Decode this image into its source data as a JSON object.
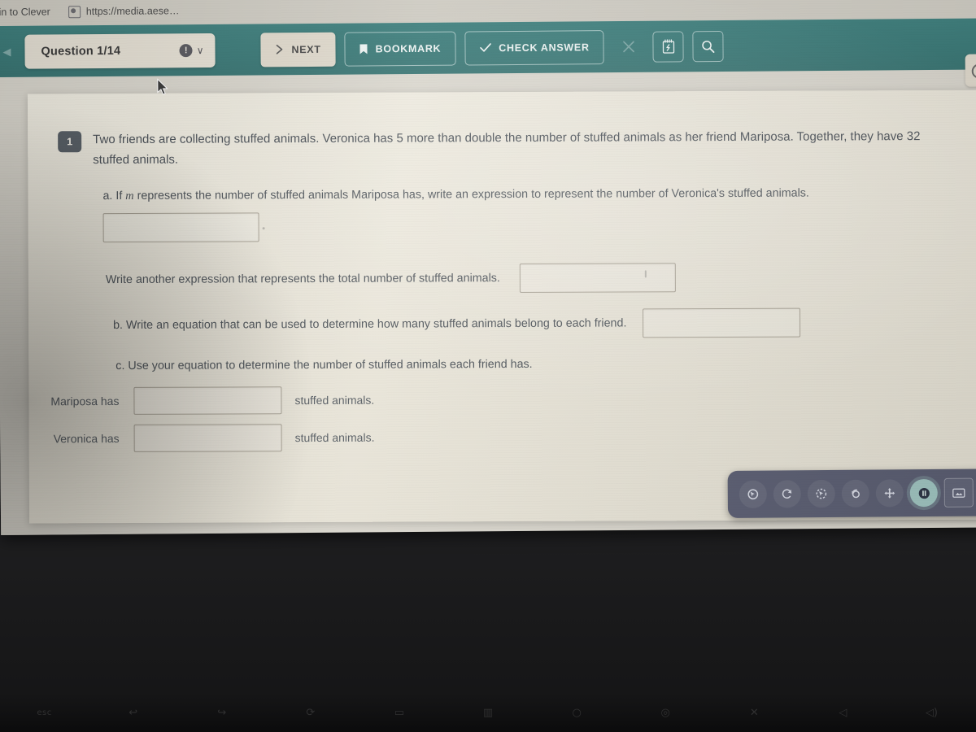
{
  "browser": {
    "bookmark_label": "g in to Clever",
    "favicon_name": "site-favicon",
    "url_text": "https://media.aese…"
  },
  "app_toolbar": {
    "back_icon": "chevron-left-icon",
    "question_label": "Question 1/14",
    "alert_glyph": "!",
    "chevron_glyph": "∨",
    "buttons": [
      {
        "label": "NEXT",
        "icon": "chevron-right-icon",
        "style": "solid"
      },
      {
        "label": "BOOKMARK",
        "icon": "bookmark-icon",
        "style": "outline"
      },
      {
        "label": "CHECK ANSWER",
        "icon": "check-icon",
        "style": "outline"
      },
      {
        "label": "",
        "icon": "close-icon",
        "style": "ghost"
      },
      {
        "label": "",
        "icon": "notepad-icon",
        "style": "outline"
      },
      {
        "label": "",
        "icon": "magnifier-icon",
        "style": "outline"
      }
    ],
    "right_edge_icon": "magnifier-icon"
  },
  "worksheet": {
    "question_number": "1",
    "stem": "Two friends are collecting stuffed animals.  Veronica has 5 more than double the number of stuffed animals as her friend Mariposa.  Together, they have 32 stuffed animals.",
    "part_a": {
      "marker": "a.",
      "text_before_var": "If ",
      "variable": "m",
      "text_after_var": " represents the number of stuffed animals Mariposa has, write an expression to represent the number of Veronica's stuffed animals.",
      "answer_value": "",
      "answer_placeholder": ""
    },
    "total_line": {
      "text": "Write another expression that represents the total number of stuffed animals.",
      "answer_value": "",
      "answer_placeholder": ""
    },
    "part_b": {
      "marker": "b.",
      "text": "Write an equation that can be used to determine how many stuffed animals belong to each friend.",
      "answer_value": "",
      "answer_placeholder": ""
    },
    "part_c": {
      "marker": "c.",
      "text": "Use your equation to determine the number of stuffed animals each friend has.",
      "rows": [
        {
          "label": "Mariposa has",
          "value": "",
          "placeholder": "",
          "suffix": "stuffed animals."
        },
        {
          "label": "Veronica has",
          "value": "",
          "placeholder": "",
          "suffix": "stuffed animals."
        }
      ]
    }
  },
  "tool_palette": {
    "tools": [
      {
        "name": "select-cursor-tool",
        "active": false
      },
      {
        "name": "rotate-tool",
        "active": false
      },
      {
        "name": "lasso-select-tool",
        "active": false
      },
      {
        "name": "rotate-object-tool",
        "active": false
      },
      {
        "name": "move-tool",
        "active": false
      },
      {
        "name": "pause-tool",
        "active": true
      },
      {
        "name": "screenshot-tool",
        "active": false
      }
    ]
  },
  "keyboard": {
    "keys": [
      {
        "name": "esc-key",
        "glyph": "esc"
      },
      {
        "name": "brightness-down-key",
        "glyph": "↩"
      },
      {
        "name": "forward-key",
        "glyph": "↪"
      },
      {
        "name": "reload-key",
        "glyph": "⟳"
      },
      {
        "name": "fullscreen-key",
        "glyph": "▭"
      },
      {
        "name": "overview-key",
        "glyph": "▥"
      },
      {
        "name": "brightness-low-key",
        "glyph": "○"
      },
      {
        "name": "brightness-high-key",
        "glyph": "◎"
      },
      {
        "name": "mute-key",
        "glyph": "✕"
      },
      {
        "name": "volume-down-key",
        "glyph": "◁"
      },
      {
        "name": "volume-up-key",
        "glyph": "◁)"
      }
    ]
  },
  "colors": {
    "toolbar_teal": "#3c7a78",
    "pill_cream": "#e6e1d5",
    "worksheet_cream": "#eae6da",
    "badge_gray": "#585f66",
    "palette_slate": "#5b5e72",
    "palette_active": "#9fc4c0"
  }
}
